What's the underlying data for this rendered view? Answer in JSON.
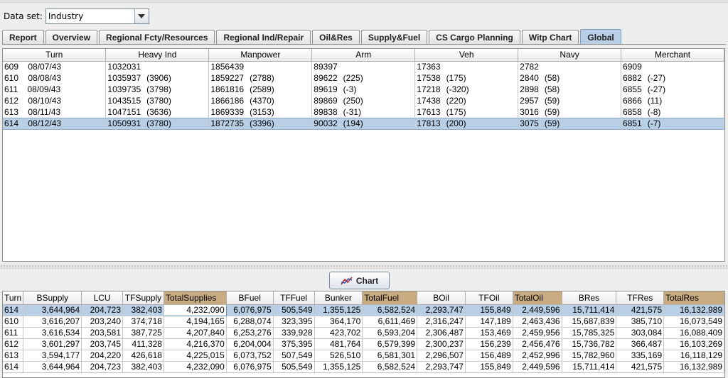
{
  "dataset": {
    "label": "Data set:",
    "value": "Industry"
  },
  "tabs": [
    {
      "label": "Report",
      "active": false
    },
    {
      "label": "Overview",
      "active": false
    },
    {
      "label": "Regional Fcty/Resources",
      "active": false
    },
    {
      "label": "Regional Ind/Repair",
      "active": false
    },
    {
      "label": "Oil&Res",
      "active": false
    },
    {
      "label": "Supply&Fuel",
      "active": false
    },
    {
      "label": "CS Cargo Planning",
      "active": false
    },
    {
      "label": "Witp Chart",
      "active": false
    },
    {
      "label": "Global",
      "active": true
    }
  ],
  "upper_table": {
    "headers": [
      "Turn",
      "Heavy Ind",
      "Manpower",
      "Arm",
      "Veh",
      "Navy",
      "Merchant"
    ],
    "rows": [
      {
        "turn": "609    08/07/43",
        "cells": [
          [
            "1032031",
            ""
          ],
          [
            "1856439",
            ""
          ],
          [
            "89397",
            ""
          ],
          [
            "17363",
            ""
          ],
          [
            "2782",
            ""
          ],
          [
            "6909",
            ""
          ]
        ],
        "selected": false
      },
      {
        "turn": "610    08/08/43",
        "cells": [
          [
            "1035937",
            "(3906)"
          ],
          [
            "1859227",
            "(2788)"
          ],
          [
            "89622",
            "(225)"
          ],
          [
            "17538",
            "(175)"
          ],
          [
            "2840",
            "(58)"
          ],
          [
            "6882",
            "(-27)"
          ]
        ],
        "selected": false
      },
      {
        "turn": "611    08/09/43",
        "cells": [
          [
            "1039735",
            "(3798)"
          ],
          [
            "1861816",
            "(2589)"
          ],
          [
            "89619",
            "(-3)"
          ],
          [
            "17218",
            "(-320)"
          ],
          [
            "2898",
            "(58)"
          ],
          [
            "6855",
            "(-27)"
          ]
        ],
        "selected": false
      },
      {
        "turn": "612    08/10/43",
        "cells": [
          [
            "1043515",
            "(3780)"
          ],
          [
            "1866186",
            "(4370)"
          ],
          [
            "89869",
            "(250)"
          ],
          [
            "17438",
            "(220)"
          ],
          [
            "2957",
            "(59)"
          ],
          [
            "6866",
            "(11)"
          ]
        ],
        "selected": false
      },
      {
        "turn": "613    08/11/43",
        "cells": [
          [
            "1047151",
            "(3636)"
          ],
          [
            "1869339",
            "(3153)"
          ],
          [
            "89838",
            "(-31)"
          ],
          [
            "17613",
            "(175)"
          ],
          [
            "3016",
            "(59)"
          ],
          [
            "6858",
            "(-8)"
          ]
        ],
        "selected": false
      },
      {
        "turn": "614    08/12/43",
        "cells": [
          [
            "1050931",
            "(3780)"
          ],
          [
            "1872735",
            "(3396)"
          ],
          [
            "90032",
            "(194)"
          ],
          [
            "17813",
            "(200)"
          ],
          [
            "3075",
            "(59)"
          ],
          [
            "6851",
            "(-7)"
          ]
        ],
        "selected": true
      }
    ]
  },
  "chart_button": {
    "label": "Chart",
    "icon": "chart-line-icon"
  },
  "lower_table": {
    "headers": [
      "Turn",
      "BSupply",
      "LCU",
      "TFSupply",
      "TotalSupplies",
      "BFuel",
      "TFFuel",
      "Bunker",
      "TotalFuel",
      "BOil",
      "TFOil",
      "TotalOil",
      "BRes",
      "TFRes",
      "TotalRes"
    ],
    "highlight_columns": [
      "TotalSupplies",
      "TotalFuel",
      "TotalOil",
      "TotalRes"
    ],
    "highlight_color": "#c9ab82",
    "rows": [
      {
        "selected": true,
        "cells": [
          "614",
          "3,644,964",
          "204,723",
          "382,403",
          "4,232,090",
          "6,076,975",
          "505,549",
          "1,355,125",
          "6,582,524",
          "2,293,747",
          "155,849",
          "2,449,596",
          "15,711,414",
          "421,575",
          "16,132,989"
        ]
      },
      {
        "selected": false,
        "cells": [
          "610",
          "3,616,207",
          "203,240",
          "374,718",
          "4,194,165",
          "6,288,074",
          "323,395",
          "364,170",
          "6,611,469",
          "2,316,247",
          "147,189",
          "2,463,436",
          "15,687,839",
          "385,710",
          "16,073,549"
        ]
      },
      {
        "selected": false,
        "cells": [
          "611",
          "3,616,534",
          "203,581",
          "387,725",
          "4,207,840",
          "6,253,276",
          "339,928",
          "423,702",
          "6,593,204",
          "2,306,487",
          "153,469",
          "2,459,956",
          "15,785,325",
          "303,084",
          "16,088,409"
        ]
      },
      {
        "selected": false,
        "cells": [
          "612",
          "3,601,297",
          "203,745",
          "411,328",
          "4,216,370",
          "6,204,004",
          "375,395",
          "481,764",
          "6,579,399",
          "2,300,237",
          "156,239",
          "2,456,476",
          "15,736,782",
          "366,487",
          "16,103,269"
        ]
      },
      {
        "selected": false,
        "cells": [
          "613",
          "3,594,177",
          "204,220",
          "426,618",
          "4,225,015",
          "6,073,752",
          "507,549",
          "526,510",
          "6,581,301",
          "2,296,507",
          "156,489",
          "2,452,996",
          "15,782,960",
          "335,169",
          "16,118,129"
        ]
      },
      {
        "selected": false,
        "cells": [
          "614",
          "3,644,964",
          "204,723",
          "382,403",
          "4,232,090",
          "6,076,975",
          "505,549",
          "1,355,125",
          "6,582,524",
          "2,293,747",
          "155,849",
          "2,449,596",
          "15,711,414",
          "421,575",
          "16,132,989"
        ]
      }
    ]
  }
}
